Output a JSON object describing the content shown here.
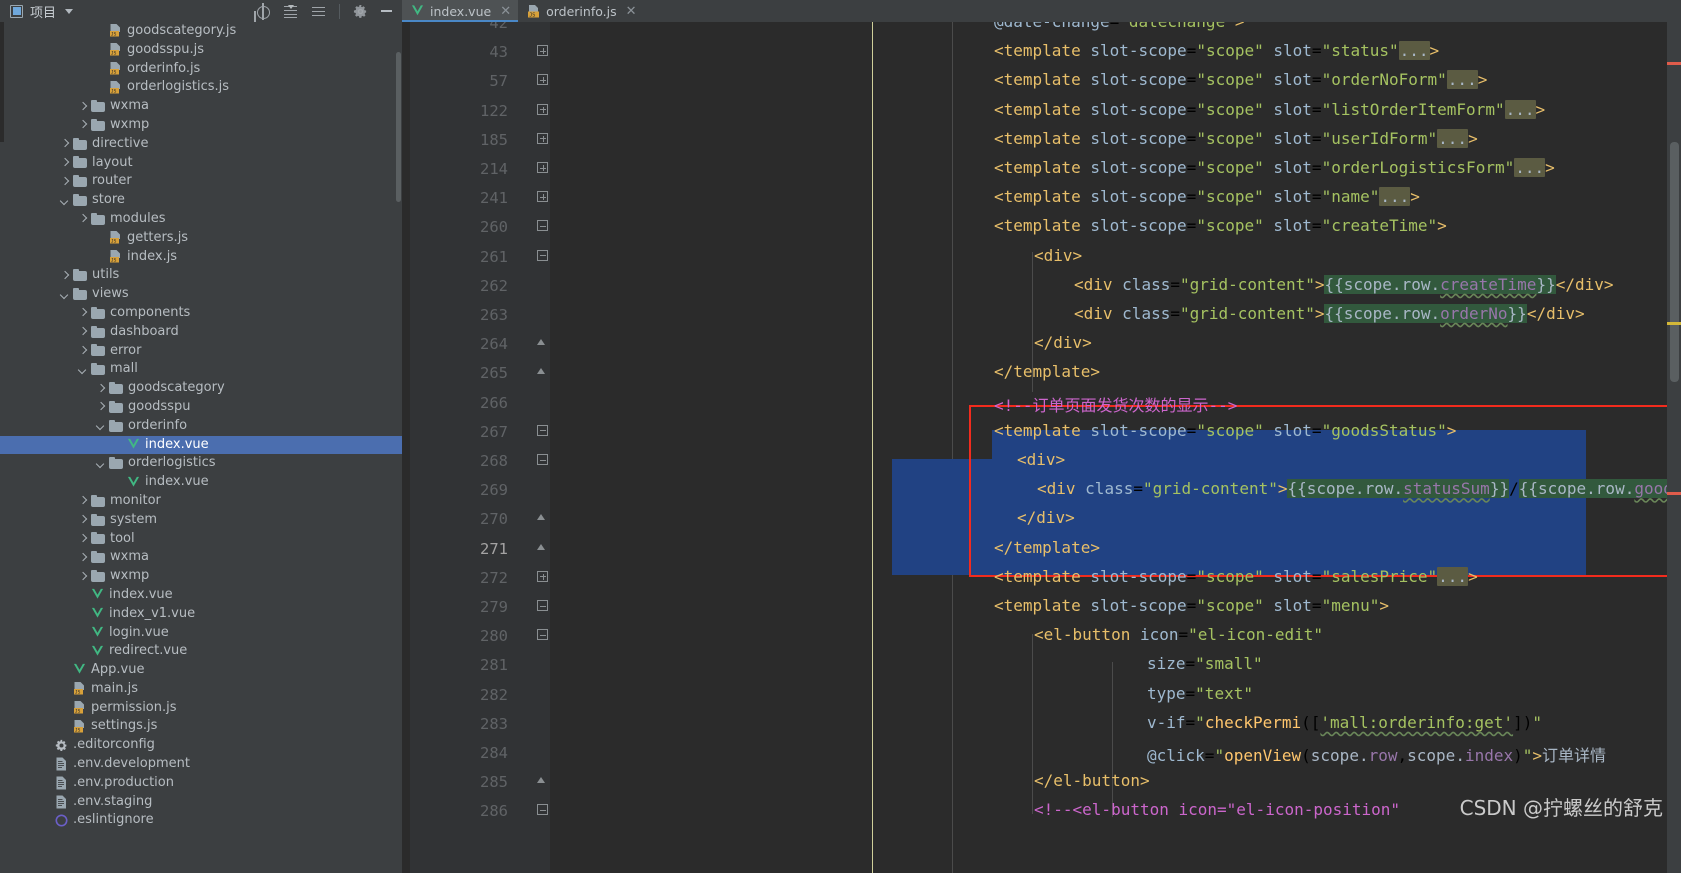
{
  "toolbar": {
    "project_label": "项目",
    "icons": [
      "locate-icon",
      "collapse-all-icon",
      "expand-all-icon",
      "gear-icon",
      "minimize-icon"
    ]
  },
  "tabs": [
    {
      "label": "index.vue",
      "icon": "vue-file-icon",
      "active": true,
      "close": "✕"
    },
    {
      "label": "orderinfo.js",
      "icon": "js-file-icon",
      "active": false,
      "close": "✕"
    }
  ],
  "tree": [
    {
      "label": "goodscategory.js",
      "indent": 5,
      "icon": "js-file-icon",
      "arrow": "none",
      "selected": false
    },
    {
      "label": "goodsspu.js",
      "indent": 5,
      "icon": "js-file-icon",
      "arrow": "none",
      "selected": false
    },
    {
      "label": "orderinfo.js",
      "indent": 5,
      "icon": "js-file-icon",
      "arrow": "none",
      "selected": false
    },
    {
      "label": "orderlogistics.js",
      "indent": 5,
      "icon": "js-file-icon",
      "arrow": "none",
      "selected": false
    },
    {
      "label": "wxma",
      "indent": 4,
      "icon": "folder-icon",
      "arrow": "right",
      "selected": false
    },
    {
      "label": "wxmp",
      "indent": 4,
      "icon": "folder-icon",
      "arrow": "right",
      "selected": false
    },
    {
      "label": "directive",
      "indent": 3,
      "icon": "folder-icon",
      "arrow": "right",
      "selected": false
    },
    {
      "label": "layout",
      "indent": 3,
      "icon": "folder-icon",
      "arrow": "right",
      "selected": false
    },
    {
      "label": "router",
      "indent": 3,
      "icon": "folder-icon",
      "arrow": "right",
      "selected": false
    },
    {
      "label": "store",
      "indent": 3,
      "icon": "folder-icon",
      "arrow": "down",
      "selected": false
    },
    {
      "label": "modules",
      "indent": 4,
      "icon": "folder-icon",
      "arrow": "right",
      "selected": false
    },
    {
      "label": "getters.js",
      "indent": 5,
      "icon": "js-file-icon",
      "arrow": "none",
      "selected": false
    },
    {
      "label": "index.js",
      "indent": 5,
      "icon": "js-file-icon",
      "arrow": "none",
      "selected": false
    },
    {
      "label": "utils",
      "indent": 3,
      "icon": "folder-icon",
      "arrow": "right",
      "selected": false
    },
    {
      "label": "views",
      "indent": 3,
      "icon": "folder-icon",
      "arrow": "down",
      "selected": false
    },
    {
      "label": "components",
      "indent": 4,
      "icon": "folder-icon",
      "arrow": "right",
      "selected": false
    },
    {
      "label": "dashboard",
      "indent": 4,
      "icon": "folder-icon",
      "arrow": "right",
      "selected": false
    },
    {
      "label": "error",
      "indent": 4,
      "icon": "folder-icon",
      "arrow": "right",
      "selected": false
    },
    {
      "label": "mall",
      "indent": 4,
      "icon": "folder-icon",
      "arrow": "down",
      "selected": false
    },
    {
      "label": "goodscategory",
      "indent": 5,
      "icon": "folder-icon",
      "arrow": "right",
      "selected": false
    },
    {
      "label": "goodsspu",
      "indent": 5,
      "icon": "folder-icon",
      "arrow": "right",
      "selected": false
    },
    {
      "label": "orderinfo",
      "indent": 5,
      "icon": "folder-icon",
      "arrow": "down",
      "selected": false
    },
    {
      "label": "index.vue",
      "indent": 6,
      "icon": "vue-file-icon",
      "arrow": "none",
      "selected": true
    },
    {
      "label": "orderlogistics",
      "indent": 5,
      "icon": "folder-icon",
      "arrow": "down",
      "selected": false
    },
    {
      "label": "index.vue",
      "indent": 6,
      "icon": "vue-file-icon",
      "arrow": "none",
      "selected": false
    },
    {
      "label": "monitor",
      "indent": 4,
      "icon": "folder-icon",
      "arrow": "right",
      "selected": false
    },
    {
      "label": "system",
      "indent": 4,
      "icon": "folder-icon",
      "arrow": "right",
      "selected": false
    },
    {
      "label": "tool",
      "indent": 4,
      "icon": "folder-icon",
      "arrow": "right",
      "selected": false
    },
    {
      "label": "wxma",
      "indent": 4,
      "icon": "folder-icon",
      "arrow": "right",
      "selected": false
    },
    {
      "label": "wxmp",
      "indent": 4,
      "icon": "folder-icon",
      "arrow": "right",
      "selected": false
    },
    {
      "label": "index.vue",
      "indent": 4,
      "icon": "vue-file-icon",
      "arrow": "none",
      "selected": false
    },
    {
      "label": "index_v1.vue",
      "indent": 4,
      "icon": "vue-file-icon",
      "arrow": "none",
      "selected": false
    },
    {
      "label": "login.vue",
      "indent": 4,
      "icon": "vue-file-icon",
      "arrow": "none",
      "selected": false
    },
    {
      "label": "redirect.vue",
      "indent": 4,
      "icon": "vue-file-icon",
      "arrow": "none",
      "selected": false
    },
    {
      "label": "App.vue",
      "indent": 3,
      "icon": "vue-file-icon",
      "arrow": "none",
      "selected": false
    },
    {
      "label": "main.js",
      "indent": 3,
      "icon": "js-file-icon",
      "arrow": "none",
      "selected": false
    },
    {
      "label": "permission.js",
      "indent": 3,
      "icon": "js-file-icon",
      "arrow": "none",
      "selected": false
    },
    {
      "label": "settings.js",
      "indent": 3,
      "icon": "js-file-icon",
      "arrow": "none",
      "selected": false
    },
    {
      "label": ".editorconfig",
      "indent": 2,
      "icon": "gear-file-icon",
      "arrow": "none",
      "selected": false
    },
    {
      "label": ".env.development",
      "indent": 2,
      "icon": "text-file-icon",
      "arrow": "none",
      "selected": false
    },
    {
      "label": ".env.production",
      "indent": 2,
      "icon": "text-file-icon",
      "arrow": "none",
      "selected": false
    },
    {
      "label": ".env.staging",
      "indent": 2,
      "icon": "text-file-icon",
      "arrow": "none",
      "selected": false
    },
    {
      "label": ".eslintignore",
      "indent": 2,
      "icon": "circle-file-icon",
      "arrow": "none",
      "selected": false
    }
  ],
  "editor": {
    "lines": [
      {
        "num": "42",
        "text": "@date-change=\"datechange\">",
        "fold": "none",
        "partial": true
      },
      {
        "num": "43",
        "text": "<template slot-scope=\"scope\" slot=\"status\"...>",
        "fold": "plus"
      },
      {
        "num": "57",
        "text": "<template slot-scope=\"scope\" slot=\"orderNoForm\"...>",
        "fold": "plus"
      },
      {
        "num": "122",
        "text": "<template slot-scope=\"scope\" slot=\"listOrderItemForm\"...>",
        "fold": "plus"
      },
      {
        "num": "185",
        "text": "<template slot-scope=\"scope\" slot=\"userIdForm\"...>",
        "fold": "plus"
      },
      {
        "num": "214",
        "text": "<template slot-scope=\"scope\" slot=\"orderLogisticsForm\"...>",
        "fold": "plus"
      },
      {
        "num": "241",
        "text": "<template slot-scope=\"scope\" slot=\"name\"...>",
        "fold": "plus"
      },
      {
        "num": "260",
        "text": "<template slot-scope=\"scope\" slot=\"createTime\">",
        "fold": "tri"
      },
      {
        "num": "261",
        "text": "<div>",
        "fold": "tri"
      },
      {
        "num": "262",
        "text": "<div class=\"grid-content\">{{scope.row.createTime}}</div>",
        "fold": "none"
      },
      {
        "num": "263",
        "text": "<div class=\"grid-content\">{{scope.row.orderNo}}</div>",
        "fold": "none"
      },
      {
        "num": "264",
        "text": "</div>",
        "fold": "cap"
      },
      {
        "num": "265",
        "text": "</template>",
        "fold": "cap"
      },
      {
        "num": "266",
        "text": "<!--订单页面发货次数的显示-->",
        "fold": "none"
      },
      {
        "num": "267",
        "text": "<template slot-scope=\"scope\" slot=\"goodsStatus\">",
        "fold": "tri"
      },
      {
        "num": "268",
        "text": "<div>",
        "fold": "tri"
      },
      {
        "num": "269",
        "text": "<div class=\"grid-content\">{{scope.row.statusSum}}/{{scope.row.goodsSum}}</div>",
        "fold": "none"
      },
      {
        "num": "270",
        "text": "</div>",
        "fold": "cap"
      },
      {
        "num": "271",
        "text": "</template>",
        "fold": "cap",
        "current": true
      },
      {
        "num": "272",
        "text": "<template slot-scope=\"scope\" slot=\"salesPrice\"...>",
        "fold": "plus"
      },
      {
        "num": "279",
        "text": "<template slot-scope=\"scope\" slot=\"menu\">",
        "fold": "tri"
      },
      {
        "num": "280",
        "text": "<el-button icon=\"el-icon-edit\"",
        "fold": "tri"
      },
      {
        "num": "281",
        "text": "size=\"small\"",
        "fold": "none"
      },
      {
        "num": "282",
        "text": "type=\"text\"",
        "fold": "none"
      },
      {
        "num": "283",
        "text": "v-if=\"checkPermi(['mall:orderinfo:get'])\"",
        "fold": "none"
      },
      {
        "num": "284",
        "text": "@click=\"openView(scope.row,scope.index)\">订单详情",
        "fold": "none"
      },
      {
        "num": "285",
        "text": "</el-button>",
        "fold": "cap"
      },
      {
        "num": "286",
        "text": "<!--<el-button icon=\"el-icon-position\"",
        "fold": "tri"
      }
    ],
    "selection_note": "lines 267-271 selected",
    "highlight_box_color": "#f22b1d",
    "selection_color": "#214283"
  },
  "watermark": "CSDN @拧螺丝的舒克"
}
